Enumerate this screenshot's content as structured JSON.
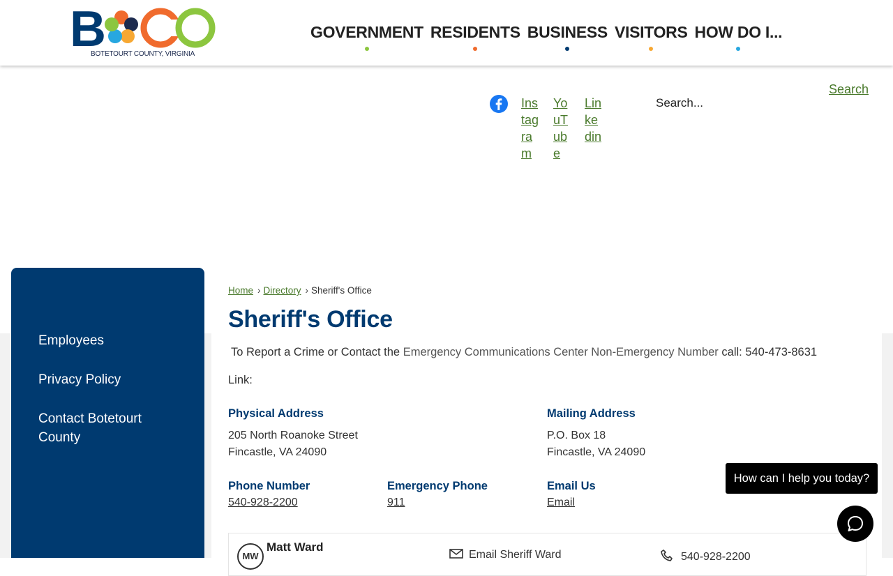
{
  "logo": {
    "letters": "BOCO",
    "caption": "BOTETOURT COUNTY, VIRGINIA"
  },
  "colors": {
    "navy": "#003a70",
    "orange": "#f06b2d",
    "green": "#8cc63f",
    "blue": "#27a7e0",
    "gold": "#f7a833",
    "link": "#4a7a2c"
  },
  "nav": [
    {
      "label": "GOVERNMENT",
      "dot": "#8cc63f"
    },
    {
      "label": "RESIDENTS",
      "dot": "#f06b2d"
    },
    {
      "label": "BUSINESS",
      "dot": "#003a70"
    },
    {
      "label": "VISITORS",
      "dot": "#f7a833"
    },
    {
      "label": "HOW DO I...",
      "dot": "#27a7e0"
    }
  ],
  "social": {
    "facebook_icon": "facebook-icon",
    "instagram": "Instagram",
    "youtube": "YouTube",
    "linkedin": "Linkedin"
  },
  "search": {
    "placeholder": "Search...",
    "button": "Search"
  },
  "sidebar": [
    {
      "label": "Employees"
    },
    {
      "label": "Privacy Policy"
    },
    {
      "label": "Contact Botetourt County"
    }
  ],
  "breadcrumb": {
    "home": "Home",
    "directory": "Directory",
    "separator": "›",
    "current": "Sheriff's Office"
  },
  "page": {
    "title": "Sheriff's Office",
    "report_prefix": "To Report a Crime or Contact the",
    "report_link": "Emergency Communications Center Non-Emergency Number",
    "report_suffix": "call: 540-473-8631",
    "link_label": "Link:"
  },
  "physical": {
    "label": "Physical Address",
    "line1": "205 North Roanoke Street",
    "line2": "Fincastle, VA 24090"
  },
  "mailing": {
    "label": "Mailing Address",
    "line1": "P.O. Box 18",
    "line2": "Fincastle, VA 24090"
  },
  "phone": {
    "label": "Phone Number",
    "value": "540-928-2200"
  },
  "emergency": {
    "label": "Emergency Phone",
    "value": "911"
  },
  "email": {
    "label": "Email Us",
    "value": "Email"
  },
  "staff": {
    "initials": "MW",
    "name": "Matt Ward",
    "email": "Email Sheriff Ward",
    "phone": "540-928-2200"
  },
  "chat": {
    "prompt": "How can I help you today?"
  }
}
